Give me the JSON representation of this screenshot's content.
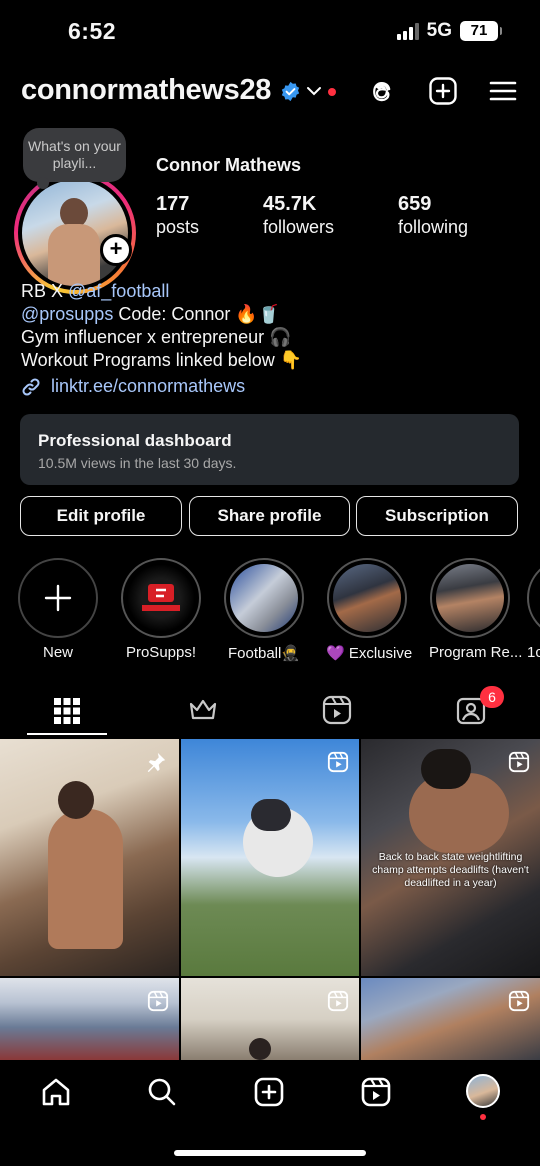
{
  "status": {
    "time": "6:52",
    "network": "5G",
    "battery": "71"
  },
  "header": {
    "username": "connormathews28"
  },
  "note": {
    "text": "What's on your playli..."
  },
  "profile": {
    "full_name": "Connor Mathews",
    "stats": [
      {
        "num": "177",
        "label": "posts"
      },
      {
        "num": "45.7K",
        "label": "followers"
      },
      {
        "num": "659",
        "label": "following"
      }
    ],
    "bio": {
      "line1_prefix": "RB X ",
      "line1_mention": "@af_football",
      "line2_mention": "@prosupps",
      "line2_rest": " Code: Connor 🔥🥤",
      "line3": "Gym influencer x entrepreneur 🎧",
      "line4": "Workout Programs linked below 👇"
    },
    "link": "linktr.ee/connormathews"
  },
  "dashboard": {
    "title": "Professional dashboard",
    "subtitle": "10.5M views in the last 30 days."
  },
  "buttons": {
    "edit": "Edit profile",
    "share": "Share profile",
    "subscription": "Subscription"
  },
  "highlights": [
    {
      "label": "New"
    },
    {
      "label": "ProSupps!"
    },
    {
      "label": "Football🥷"
    },
    {
      "label": "💜 Exclusive"
    },
    {
      "label": "Program Re..."
    },
    {
      "label": "1c"
    }
  ],
  "tabs": {
    "tagged_count": "6"
  },
  "grid": {
    "caption": "Back to back state weightlifting champ attempts deadlifts (haven't deadlifted in a year)"
  },
  "colors": {
    "accent_blue": "#a8c7fa",
    "verified": "#3897f0",
    "notification": "#ff3040"
  }
}
